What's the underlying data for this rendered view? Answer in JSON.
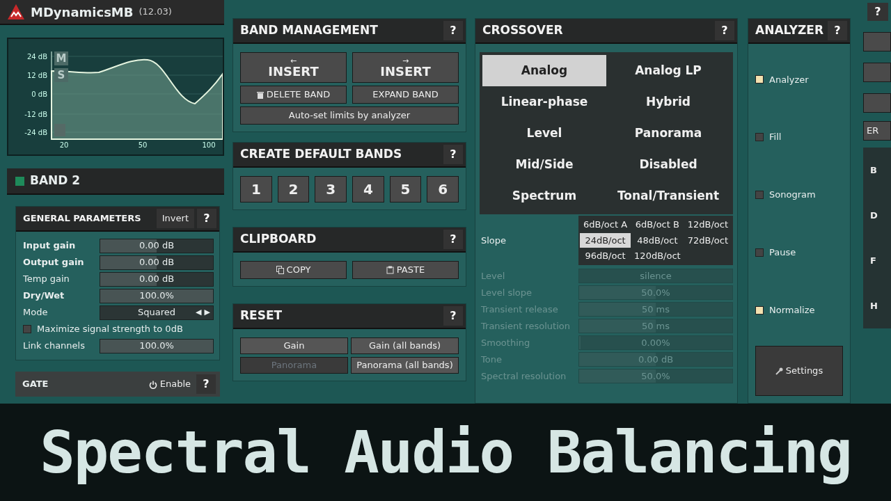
{
  "app": {
    "title": "MDynamicsMB",
    "version": "(12.03)"
  },
  "graph": {
    "y_labels": [
      "24 dB",
      "12 dB",
      "0 dB",
      "-12 dB",
      "-24 dB"
    ],
    "x_labels": [
      "20",
      "50",
      "100"
    ],
    "buttons": [
      "M",
      "S"
    ]
  },
  "band": {
    "title": "BAND 2"
  },
  "general": {
    "title": "GENERAL PARAMETERS",
    "invert": "Invert",
    "help": "?",
    "rows": [
      {
        "kind": "slider",
        "label": "Input gain",
        "value": "0.00 dB",
        "level": 0.5,
        "bold": true
      },
      {
        "kind": "slider",
        "label": "Output gain",
        "value": "0.00 dB",
        "level": 0.5,
        "bold": true
      },
      {
        "kind": "slider",
        "label": "Temp gain",
        "value": "0.00 dB",
        "level": 0.5,
        "bold": false
      },
      {
        "kind": "slider",
        "label": "Dry/Wet",
        "value": "100.0%",
        "level": 1,
        "bold": true
      },
      {
        "kind": "choice",
        "label": "Mode",
        "value": "Squared",
        "prev": "◀",
        "next": "▶",
        "bold": false
      },
      {
        "kind": "checkbox",
        "label": "Maximize signal strength to 0dB",
        "checked": false
      },
      {
        "kind": "slider",
        "label": "Link channels",
        "value": "100.0%",
        "level": 1,
        "bold": false
      }
    ]
  },
  "gate": {
    "title": "GATE",
    "enable": "Enable",
    "help": "?"
  },
  "band_management": {
    "title": "BAND MANAGEMENT",
    "help": "?",
    "insert": [
      {
        "arrow": "←",
        "label": "INSERT"
      },
      {
        "arrow": "→",
        "label": "INSERT"
      }
    ],
    "delete": "DELETE BAND",
    "expand": "EXPAND BAND",
    "auto": "Auto-set limits by analyzer"
  },
  "default_bands": {
    "title": "CREATE DEFAULT BANDS",
    "help": "?",
    "buttons": [
      "1",
      "2",
      "3",
      "4",
      "5",
      "6"
    ]
  },
  "clipboard": {
    "title": "CLIPBOARD",
    "help": "?",
    "buttons": [
      {
        "kind": "copy",
        "label": "COPY"
      },
      {
        "kind": "paste",
        "label": "PASTE"
      }
    ]
  },
  "reset": {
    "title": "RESET",
    "help": "?",
    "buttons": [
      {
        "label": "Gain",
        "disabled": false
      },
      {
        "label": "Gain (all bands)",
        "disabled": false
      },
      {
        "label": "Panorama",
        "disabled": true
      },
      {
        "label": "Panorama (all bands)",
        "disabled": false
      }
    ]
  },
  "crossover": {
    "title": "CROSSOVER",
    "help": "?",
    "modes": [
      {
        "label": "Analog",
        "selected": true
      },
      {
        "label": "Analog LP",
        "selected": false
      },
      {
        "label": "Linear-phase",
        "selected": false
      },
      {
        "label": "Hybrid",
        "selected": false
      },
      {
        "label": "Level",
        "selected": false
      },
      {
        "label": "Panorama",
        "selected": false
      },
      {
        "label": "Mid/Side",
        "selected": false
      },
      {
        "label": "Disabled",
        "selected": false
      },
      {
        "label": "Spectrum",
        "selected": false
      },
      {
        "label": "Tonal/Transient",
        "selected": false
      }
    ],
    "slope": {
      "label": "Slope",
      "options": [
        {
          "label": "6dB/oct A",
          "selected": false
        },
        {
          "label": "6dB/oct B",
          "selected": false
        },
        {
          "label": "12dB/oct",
          "selected": false
        },
        {
          "label": "24dB/oct",
          "selected": true
        },
        {
          "label": "48dB/oct",
          "selected": false
        },
        {
          "label": "72dB/oct",
          "selected": false
        },
        {
          "label": "96dB/oct",
          "selected": false
        },
        {
          "label": "120dB/oct",
          "selected": false
        }
      ]
    },
    "params": [
      {
        "kind": "choice",
        "label": "Level",
        "value": "silence",
        "disabled": true
      },
      {
        "kind": "slider",
        "label": "Level slope",
        "value": "50.0%",
        "level": 0.5,
        "disabled": true
      },
      {
        "kind": "slider",
        "label": "Transient release",
        "value": "50 ms",
        "level": 0.5,
        "disabled": true
      },
      {
        "kind": "slider",
        "label": "Transient resolution",
        "value": "50 ms",
        "level": 0.5,
        "disabled": true
      },
      {
        "kind": "slider",
        "label": "Smoothing",
        "value": "0.00%",
        "level": 0,
        "disabled": true
      },
      {
        "kind": "slider",
        "label": "Tone",
        "value": "0.00 dB",
        "level": 0.5,
        "disabled": true
      },
      {
        "kind": "slider",
        "label": "Spectral resolution",
        "value": "50.0%",
        "level": 0.5,
        "disabled": true
      }
    ]
  },
  "analyzer": {
    "title": "ANALYZER",
    "help": "?",
    "options": [
      {
        "label": "Analyzer",
        "checked": true
      },
      {
        "label": "Fill",
        "checked": false
      },
      {
        "label": "Sonogram",
        "checked": false
      },
      {
        "label": "Pause",
        "checked": false
      },
      {
        "label": "Normalize",
        "checked": true
      }
    ],
    "settings": "Settings"
  },
  "side_strip": {
    "help": "?",
    "button": "ER",
    "letters": [
      "B",
      "D",
      "F",
      "H"
    ]
  },
  "banner": "Spectral Audio Balancing"
}
